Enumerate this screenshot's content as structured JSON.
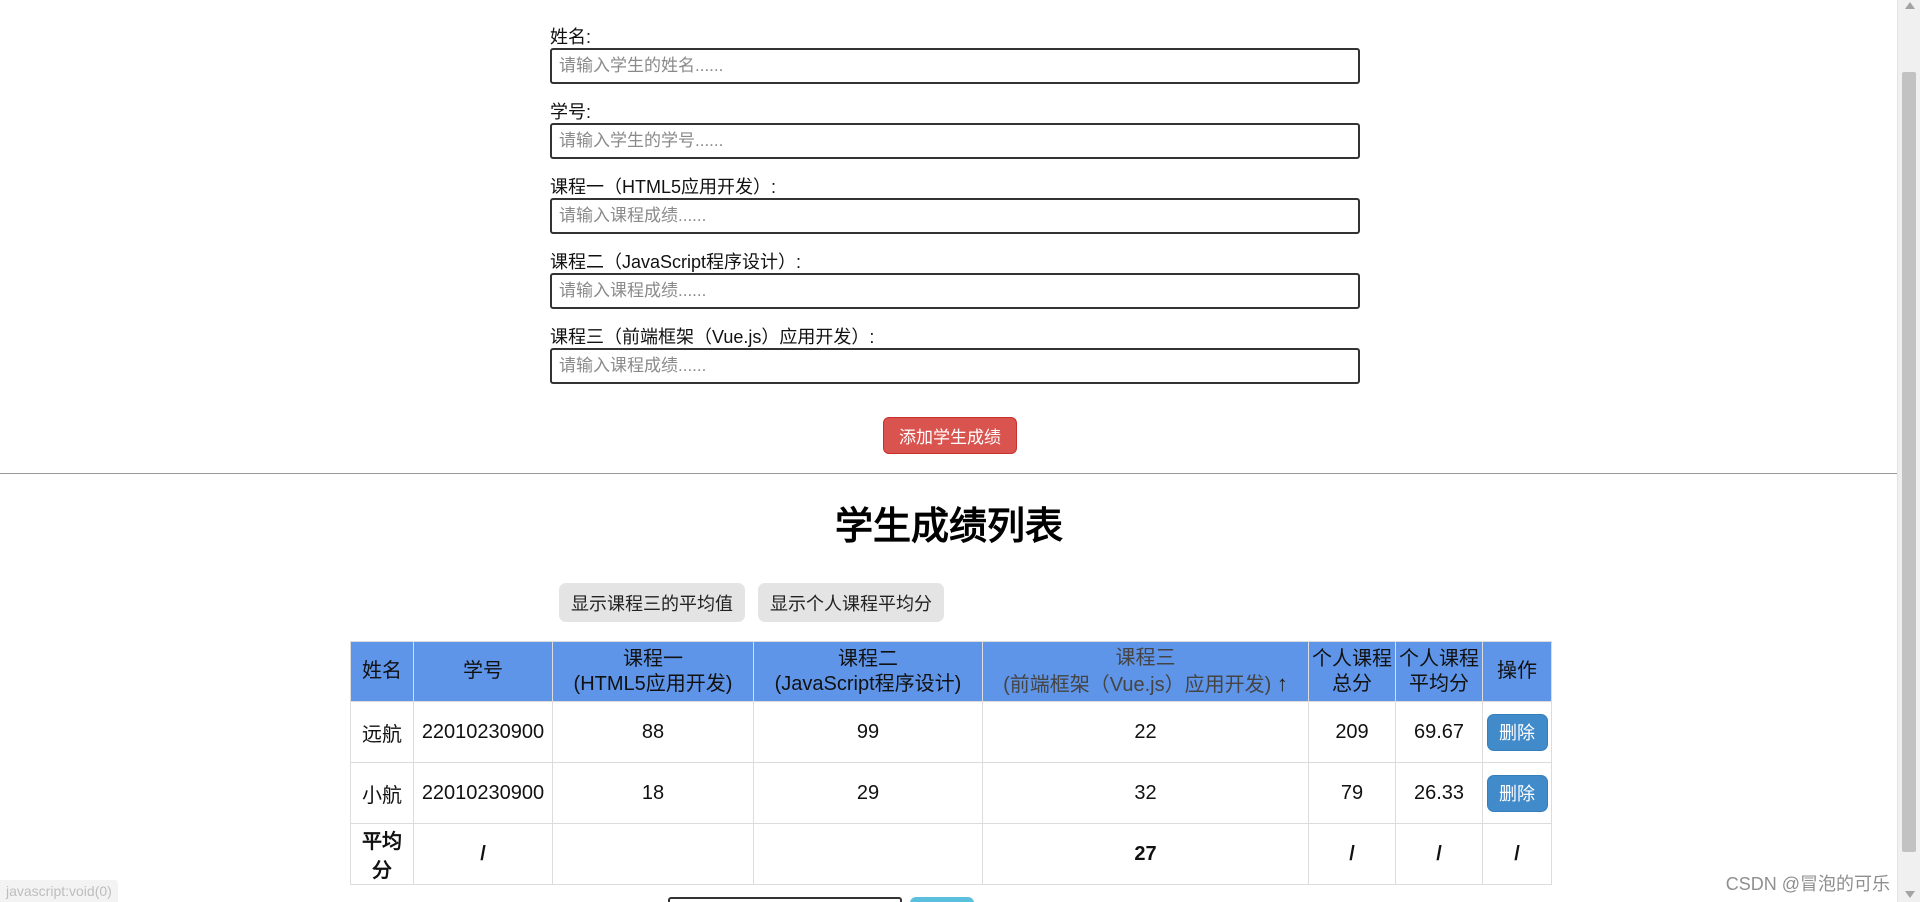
{
  "form": {
    "fields": [
      {
        "label": "姓名:",
        "placeholder": "请输入学生的姓名......"
      },
      {
        "label": "学号:",
        "placeholder": "请输入学生的学号......"
      },
      {
        "label": "课程一（HTML5应用开发）:",
        "placeholder": "请输入课程成绩......"
      },
      {
        "label": "课程二（JavaScript程序设计）:",
        "placeholder": "请输入课程成绩......"
      },
      {
        "label": "课程三（前端框架（Vue.js）应用开发）:",
        "placeholder": "请输入课程成绩......"
      }
    ],
    "add_button": "添加学生成绩"
  },
  "list": {
    "title": "学生成绩列表",
    "btn_course3_avg": "显示课程三的平均值",
    "btn_personal_avg": "显示个人课程平均分"
  },
  "table": {
    "headers": {
      "name": "姓名",
      "id": "学号",
      "c1_line1": "课程一",
      "c1_line2": "(HTML5应用开发)",
      "c2_line1": "课程二",
      "c2_line2": "(JavaScript程序设计)",
      "c3_line1": "课程三",
      "c3_line2": "(前端框架（Vue.js）应用开发)",
      "c3_sort_arrow": "↑",
      "total_line1": "个人课程",
      "total_line2": "总分",
      "avg_line1": "个人课程",
      "avg_line2": "平均分",
      "action": "操作"
    },
    "rows": [
      {
        "name": "远航",
        "id": "22010230900",
        "c1": "88",
        "c2": "99",
        "c3": "22",
        "total": "209",
        "avg": "69.67",
        "action": "删除"
      },
      {
        "name": "小航",
        "id": "22010230900",
        "c1": "18",
        "c2": "29",
        "c3": "32",
        "total": "79",
        "avg": "26.33",
        "action": "删除"
      }
    ],
    "average_row": {
      "label": "平均分",
      "id": "/",
      "c1": "",
      "c2": "",
      "c3": "27",
      "total": "/",
      "avg": "/",
      "action": "/"
    }
  },
  "status_bar": "javascript:void(0)",
  "watermark": "CSDN @冒泡的可乐",
  "colors": {
    "header_bg": "#5f95e8",
    "add_button": "#d9534f",
    "delete_button": "#428bca"
  }
}
